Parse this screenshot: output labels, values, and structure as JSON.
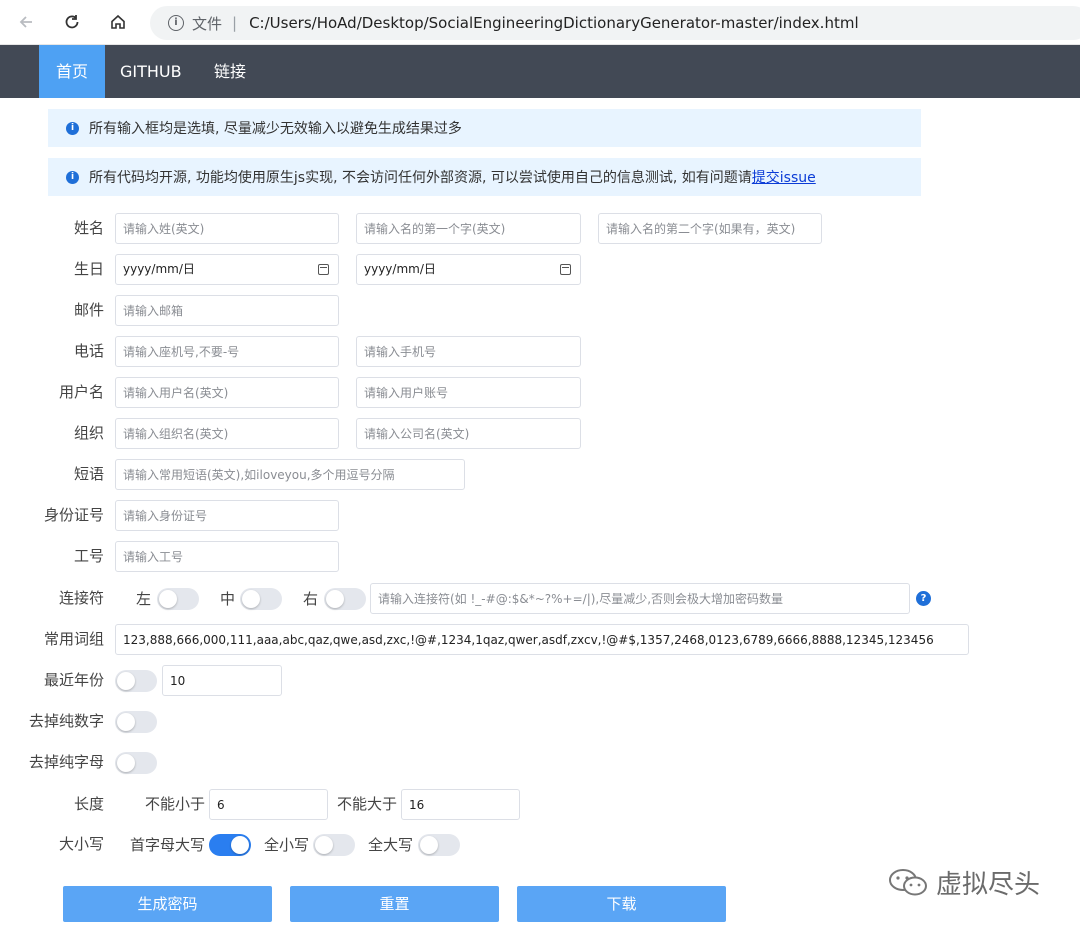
{
  "browser": {
    "file_label": "文件",
    "url": "C:/Users/HoAd/Desktop/SocialEngineeringDictionaryGenerator-master/index.html"
  },
  "nav": {
    "home": "首页",
    "github": "GITHUB",
    "links": "链接"
  },
  "alerts": {
    "a1": "所有输入框均是选填, 尽量减少无效输入以避免生成结果过多",
    "a2_text": "所有代码均开源, 功能均使用原生js实现, 不会访问任何外部资源, 可以尝试使用自己的信息测试, 如有问题请",
    "a2_link": "提交issue"
  },
  "form": {
    "name": {
      "label": "姓名",
      "p1": "请输入姓(英文)",
      "p2": "请输入名的第一个字(英文)",
      "p3": "请输入名的第二个字(如果有，英文)"
    },
    "birthday": {
      "label": "生日",
      "d1": "yyyy/mm/日",
      "d2": "yyyy/mm/日"
    },
    "email": {
      "label": "邮件",
      "p1": "请输入邮箱"
    },
    "phone": {
      "label": "电话",
      "p1": "请输入座机号,不要-号",
      "p2": "请输入手机号"
    },
    "username": {
      "label": "用户名",
      "p1": "请输入用户名(英文)",
      "p2": "请输入用户账号"
    },
    "org": {
      "label": "组织",
      "p1": "请输入组织名(英文)",
      "p2": "请输入公司名(英文)"
    },
    "phrase": {
      "label": "短语",
      "p1": "请输入常用短语(英文),如iloveyou,多个用逗号分隔"
    },
    "idcard": {
      "label": "身份证号",
      "p1": "请输入身份证号"
    },
    "workno": {
      "label": "工号",
      "p1": "请输入工号"
    },
    "connector": {
      "label": "连接符",
      "left": "左",
      "middle": "中",
      "right": "右",
      "p1": "请输入连接符(如 !_-#@:$&*~?%+=/|),尽量减少,否则会极大增加密码数量",
      "help": "?"
    },
    "common": {
      "label": "常用词组",
      "value": "123,888,666,000,111,aaa,abc,qaz,qwe,asd,zxc,!@#,1234,1qaz,qwer,asdf,zxcv,!@#$,1357,2468,0123,6789,6666,8888,12345,123456"
    },
    "recent_years": {
      "label": "最近年份",
      "value": "10"
    },
    "remove_digits": {
      "label": "去掉纯数字"
    },
    "remove_letters": {
      "label": "去掉纯字母"
    },
    "length": {
      "label": "长度",
      "min_label": "不能小于",
      "min": "6",
      "max_label": "不能大于",
      "max": "16"
    },
    "case": {
      "label": "大小写",
      "capitalize": "首字母大写",
      "lower": "全小写",
      "upper": "全大写"
    }
  },
  "buttons": {
    "generate": "生成密码",
    "reset": "重置",
    "download": "下载"
  },
  "watermark": "虚拟尽头",
  "colors": {
    "nav_bg": "#424955",
    "accent": "#4ea1f3",
    "switch_on": "#2a7ef0",
    "alert_bg": "#e8f4ff"
  }
}
